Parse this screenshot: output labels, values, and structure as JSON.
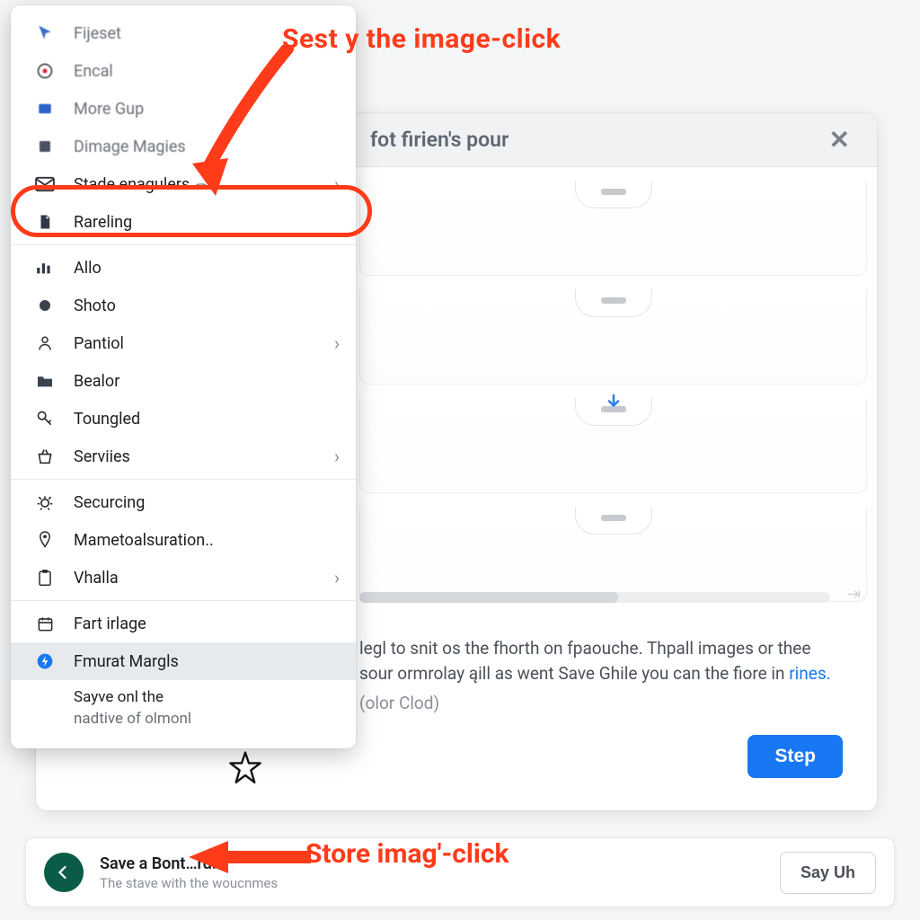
{
  "annotations": {
    "top_label": "Sest y the image-click",
    "bottom_label": "Store imag'-click"
  },
  "sidebar": {
    "items": [
      {
        "icon": "cursor-icon",
        "label": "Fijeset",
        "chevron": false,
        "blurred": true
      },
      {
        "icon": "target-icon",
        "label": "Encal",
        "chevron": false,
        "blurred": true
      },
      {
        "icon": "card-icon",
        "label": "More Gup",
        "chevron": false,
        "blurred": true
      },
      {
        "icon": "square-icon",
        "label": "Dimage Magies",
        "chevron": false,
        "blurred": true
      },
      {
        "icon": "envelope-icon",
        "label": "Stade enagulers.",
        "wifi": true,
        "chevron": true,
        "highlighted": true
      },
      {
        "icon": "document-icon",
        "label": "Rareling",
        "chevron": false
      },
      {
        "divider": true
      },
      {
        "icon": "chart-icon",
        "label": "Allo",
        "chevron": false
      },
      {
        "icon": "dot-icon",
        "label": "Shoto",
        "chevron": false
      },
      {
        "icon": "person-icon",
        "label": "Pantiol",
        "chevron": true
      },
      {
        "icon": "folder-icon",
        "label": "Bealor",
        "chevron": false
      },
      {
        "icon": "key-icon",
        "label": "Toungled",
        "chevron": false
      },
      {
        "icon": "basket-icon",
        "label": "Serviies",
        "chevron": true
      },
      {
        "divider": true
      },
      {
        "icon": "bug-icon",
        "label": "Securcing",
        "chevron": false
      },
      {
        "icon": "pin-icon",
        "label": "Mametoalsuration..",
        "chevron": false
      },
      {
        "icon": "clipboard-icon",
        "label": "Vhalla",
        "chevron": true
      },
      {
        "divider": true
      },
      {
        "icon": "calendar-icon",
        "label": "Fart irlage",
        "chevron": false
      },
      {
        "icon": "bolt-icon",
        "label": "Fmurat Margls",
        "chevron": false,
        "active": true
      },
      {
        "sub": true,
        "label": "Sayve onl the",
        "subline": "nadtive of olmonl"
      }
    ]
  },
  "dialog": {
    "title": "fot firien's pour",
    "body_line1": "legl to snit os the fhorth on fpaouche. Thpall images or thee",
    "body_line2": "sour ormrolay ąill as went Save Ghile you can the fiore in ",
    "link_text": "rines.",
    "muted_text": "(olor Clod)",
    "step_button": "Step"
  },
  "footer": {
    "headline": "Save a Bont…rd.",
    "subline": "The stave with the woucnmes",
    "secondary_button": "Say Uh"
  },
  "colors": {
    "accent_red": "#ff3b1a",
    "primary_blue": "#1877F2",
    "circle_green": "#0a5c49"
  }
}
